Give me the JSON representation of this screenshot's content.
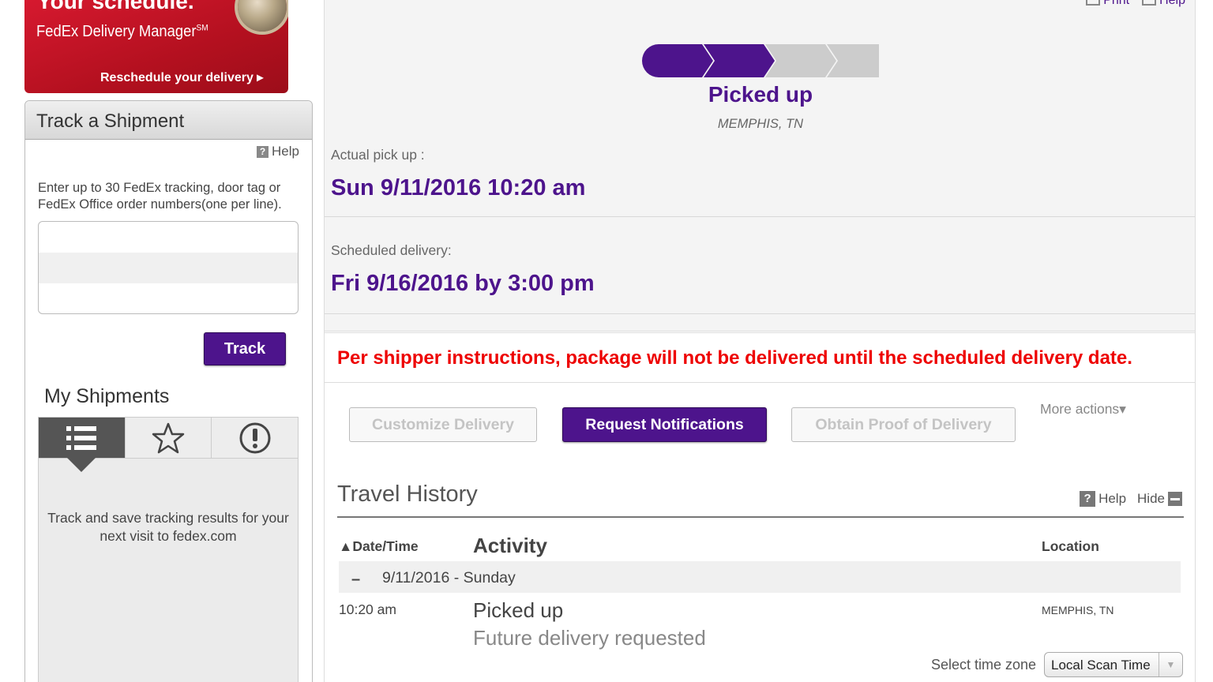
{
  "promo": {
    "title": "Your schedule.",
    "product": "FedEx Delivery Manager",
    "product_mark": "SM",
    "link": "Reschedule your delivery ▸"
  },
  "track_panel": {
    "title": "Track a Shipment",
    "help": "Help",
    "instructions": "Enter up to 30 FedEx tracking, door tag or FedEx Office order numbers(one per line).",
    "textarea_value": "",
    "track_button": "Track",
    "my_shipments_title": "My Shipments",
    "tabs": [
      {
        "icon": "list-icon",
        "active": true
      },
      {
        "icon": "star-icon",
        "active": false
      },
      {
        "icon": "exclamation-circle-icon",
        "active": false
      }
    ],
    "empty_message": "Track and save tracking results for your next visit to fedex.com"
  },
  "top_links": {
    "print": "Print",
    "help": "Help"
  },
  "status": {
    "steps_total": 4,
    "steps_completed": 2,
    "label": "Picked up",
    "location": "MEMPHIS, TN",
    "colors": {
      "done": "#4d148c",
      "pending": "#cccccc"
    }
  },
  "pickup": {
    "label": "Actual pick up :",
    "value": "Sun 9/11/2016 10:20 am"
  },
  "delivery": {
    "label": "Scheduled delivery:",
    "value": "Fri 9/16/2016 by 3:00 pm"
  },
  "warning": "Per shipper instructions, package will not be delivered until the scheduled delivery date.",
  "actions": {
    "customize": "Customize Delivery",
    "notifications": "Request Notifications",
    "proof": "Obtain Proof of Delivery",
    "more": "More actions▾"
  },
  "travel_history": {
    "title": "Travel History",
    "help": "Help",
    "hide": "Hide",
    "columns": {
      "datetime": "▲Date/Time",
      "activity": "Activity",
      "location": "Location"
    },
    "groups": [
      {
        "toggle": "–",
        "date": "9/11/2016 - Sunday",
        "events": [
          {
            "time": "10:20 am",
            "activity": "Picked up",
            "detail": "Future delivery requested",
            "location": "MEMPHIS, TN"
          }
        ]
      }
    ],
    "timezone_label": "Select time zone",
    "timezone_value": "Local Scan Time"
  }
}
